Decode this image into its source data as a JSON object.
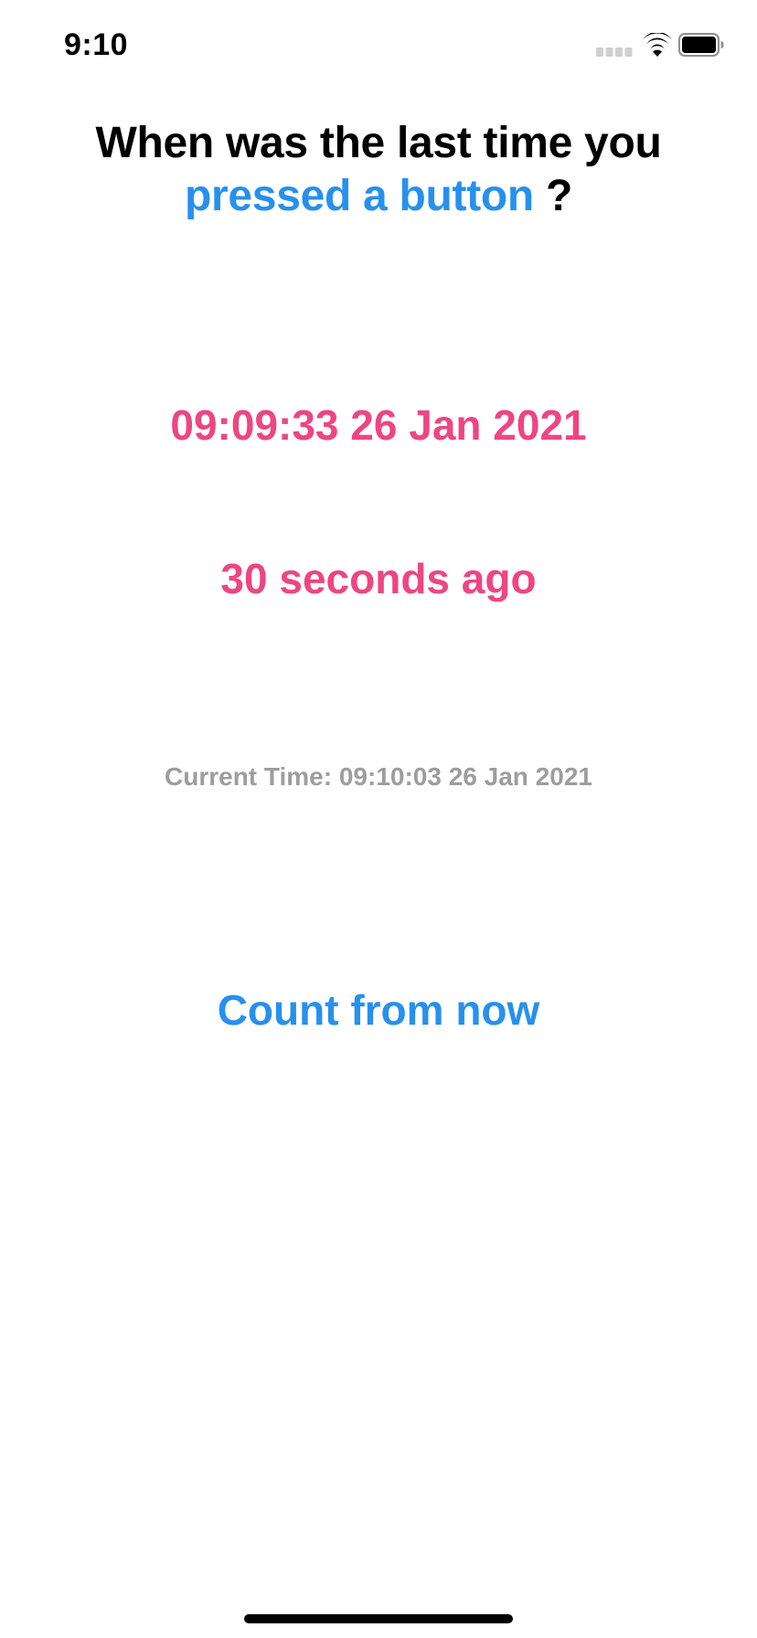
{
  "status_bar": {
    "time": "9:10",
    "icons": [
      "signal-icon",
      "wifi-icon",
      "battery-icon"
    ]
  },
  "question": {
    "line1": "When was the last time you",
    "accent": "pressed a button",
    "suffix": " ?"
  },
  "last_pressed": "09:09:33 26 Jan 2021",
  "elapsed": "30 seconds ago",
  "current_time": "Current Time: 09:10:03 26 Jan 2021",
  "count_button_label": "Count from now",
  "colors": {
    "accent_blue": "#2790ee",
    "accent_pink": "#ee4583",
    "muted_gray": "#9d9d9d"
  }
}
